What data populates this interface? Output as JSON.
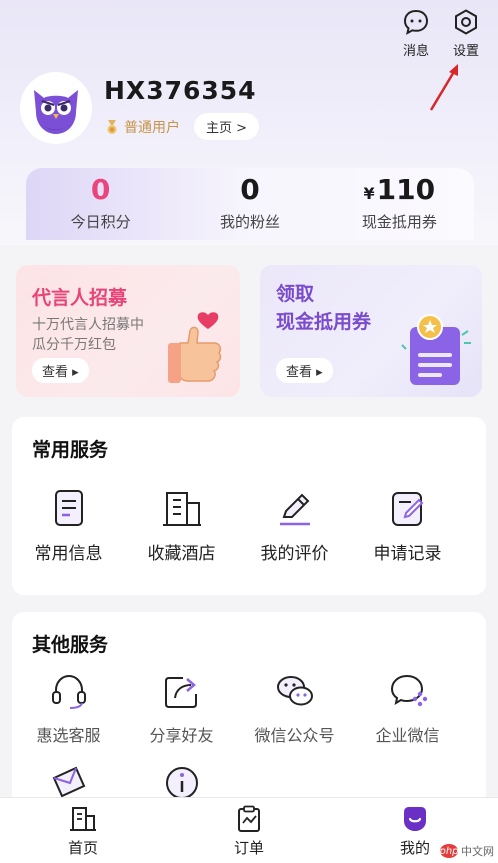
{
  "header": {
    "messages_label": "消息",
    "settings_label": "设置"
  },
  "profile": {
    "username": "HX376354",
    "level": "普通用户",
    "homepage": "主页 >"
  },
  "stats": [
    {
      "value": "0",
      "label": "今日积分"
    },
    {
      "value": "0",
      "label": "我的粉丝"
    },
    {
      "currency": "¥",
      "value": "110",
      "label": "现金抵用券"
    }
  ],
  "promos": {
    "spokesperson": {
      "title": "代言人招募",
      "sub_line1": "十万代言人招募中",
      "sub_line2": "瓜分千万红包",
      "button": "查看 ▸"
    },
    "voucher": {
      "title_line1": "领取",
      "title_line2": "现金抵用券",
      "button": "查看 ▸"
    }
  },
  "common_services": {
    "title": "常用服务",
    "items": [
      {
        "label": "常用信息",
        "icon": "document-icon"
      },
      {
        "label": "收藏酒店",
        "icon": "building-icon"
      },
      {
        "label": "我的评价",
        "icon": "pen-icon"
      },
      {
        "label": "申请记录",
        "icon": "edit-record-icon"
      }
    ]
  },
  "other_services": {
    "title": "其他服务",
    "items": [
      {
        "label": "惠选客服",
        "icon": "headset-icon"
      },
      {
        "label": "分享好友",
        "icon": "share-icon"
      },
      {
        "label": "微信公众号",
        "icon": "wechat-icon"
      },
      {
        "label": "企业微信",
        "icon": "wecom-icon"
      }
    ],
    "more_icons": [
      "mail-icon",
      "info-icon"
    ]
  },
  "tabbar": [
    {
      "label": "首页",
      "icon": "home-building-icon"
    },
    {
      "label": "订单",
      "icon": "order-clipboard-icon"
    },
    {
      "label": "我的",
      "icon": "profile-face-icon",
      "active": true
    }
  ],
  "watermark": {
    "logo": "php",
    "text": "中文网"
  },
  "colors": {
    "accent_purple": "#7a4ccc",
    "accent_pink": "#e8467d",
    "gold": "#c79549"
  }
}
